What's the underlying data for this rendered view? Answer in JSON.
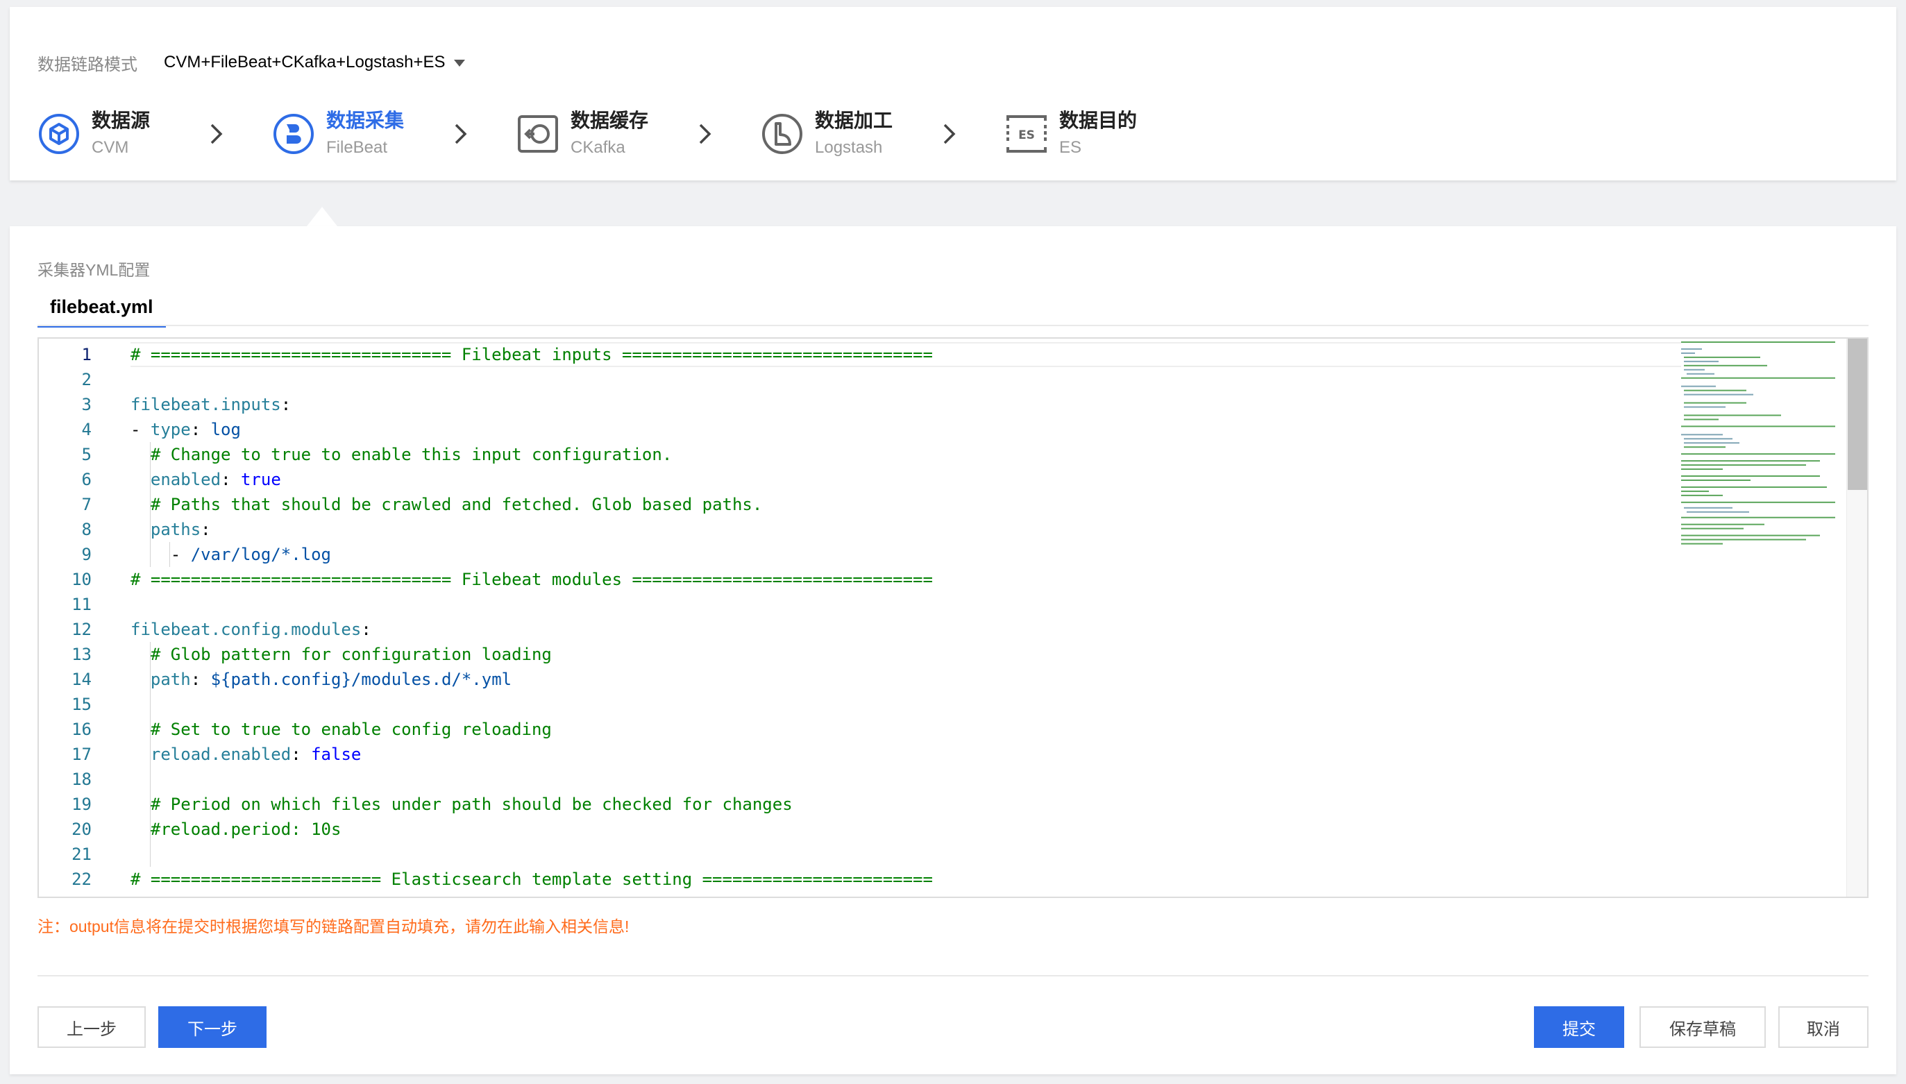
{
  "header": {
    "mode_label": "数据链路模式",
    "mode_value": "CVM+FileBeat+CKafka+Logstash+ES"
  },
  "steps": [
    {
      "title": "数据源",
      "sub": "CVM",
      "icon": "cvm-icon"
    },
    {
      "title": "数据采集",
      "sub": "FileBeat",
      "icon": "filebeat-icon",
      "active": true
    },
    {
      "title": "数据缓存",
      "sub": "CKafka",
      "icon": "ckafka-icon"
    },
    {
      "title": "数据加工",
      "sub": "Logstash",
      "icon": "logstash-icon"
    },
    {
      "title": "数据目的",
      "sub": "ES",
      "icon": "es-icon"
    }
  ],
  "config": {
    "section_label": "采集器YML配置",
    "tab_label": "filebeat.yml"
  },
  "editor": {
    "line_numbers": [
      "1",
      "2",
      "3",
      "4",
      "5",
      "6",
      "7",
      "8",
      "9",
      "10",
      "11",
      "12",
      "13",
      "14",
      "15",
      "16",
      "17",
      "18",
      "19",
      "20",
      "21",
      "22"
    ],
    "lines": [
      [
        {
          "t": "# ============================== Filebeat inputs ===============================",
          "c": "comment"
        }
      ],
      [],
      [
        {
          "t": "filebeat.inputs",
          "c": "key"
        },
        {
          "t": ":",
          "c": "plain"
        }
      ],
      [
        {
          "t": "- ",
          "c": "plain"
        },
        {
          "t": "type",
          "c": "key"
        },
        {
          "t": ": ",
          "c": "plain"
        },
        {
          "t": "log",
          "c": "str"
        }
      ],
      [
        {
          "t": "  ",
          "c": "plain"
        },
        {
          "t": "# Change to true to enable this input configuration.",
          "c": "comment"
        }
      ],
      [
        {
          "t": "  ",
          "c": "plain"
        },
        {
          "t": "enabled",
          "c": "key"
        },
        {
          "t": ": ",
          "c": "plain"
        },
        {
          "t": "true",
          "c": "bool"
        }
      ],
      [
        {
          "t": "  ",
          "c": "plain"
        },
        {
          "t": "# Paths that should be crawled and fetched. Glob based paths.",
          "c": "comment"
        }
      ],
      [
        {
          "t": "  ",
          "c": "plain"
        },
        {
          "t": "paths",
          "c": "key"
        },
        {
          "t": ":",
          "c": "plain"
        }
      ],
      [
        {
          "t": "    - ",
          "c": "plain"
        },
        {
          "t": "/var/log/*.log",
          "c": "str"
        }
      ],
      [
        {
          "t": "# ============================== Filebeat modules ==============================",
          "c": "comment"
        }
      ],
      [],
      [
        {
          "t": "filebeat.config.modules",
          "c": "key"
        },
        {
          "t": ":",
          "c": "plain"
        }
      ],
      [
        {
          "t": "  ",
          "c": "plain"
        },
        {
          "t": "# Glob pattern for configuration loading",
          "c": "comment"
        }
      ],
      [
        {
          "t": "  ",
          "c": "plain"
        },
        {
          "t": "path",
          "c": "key"
        },
        {
          "t": ": ",
          "c": "plain"
        },
        {
          "t": "${path.config}/modules.d/*.yml",
          "c": "str"
        }
      ],
      [],
      [
        {
          "t": "  ",
          "c": "plain"
        },
        {
          "t": "# Set to true to enable config reloading",
          "c": "comment"
        }
      ],
      [
        {
          "t": "  ",
          "c": "plain"
        },
        {
          "t": "reload.enabled",
          "c": "key"
        },
        {
          "t": ": ",
          "c": "plain"
        },
        {
          "t": "false",
          "c": "bool"
        }
      ],
      [],
      [
        {
          "t": "  ",
          "c": "plain"
        },
        {
          "t": "# Period on which files under path should be checked for changes",
          "c": "comment"
        }
      ],
      [
        {
          "t": "  ",
          "c": "plain"
        },
        {
          "t": "#reload.period: 10s",
          "c": "comment"
        }
      ],
      [],
      [
        {
          "t": "# ======================= Elasticsearch template setting =======================",
          "c": "comment"
        }
      ]
    ]
  },
  "note": "注：output信息将在提交时根据您填写的链路配置自动填充，请勿在此输入相关信息!",
  "buttons": {
    "prev": "上一步",
    "next": "下一步",
    "submit": "提交",
    "save_draft": "保存草稿",
    "cancel": "取消"
  },
  "colors": {
    "primary": "#2e6ce6",
    "note": "#ff6b1c",
    "comment": "#008000",
    "key": "#267f99",
    "string": "#0451a5",
    "bool": "#0000ff"
  }
}
